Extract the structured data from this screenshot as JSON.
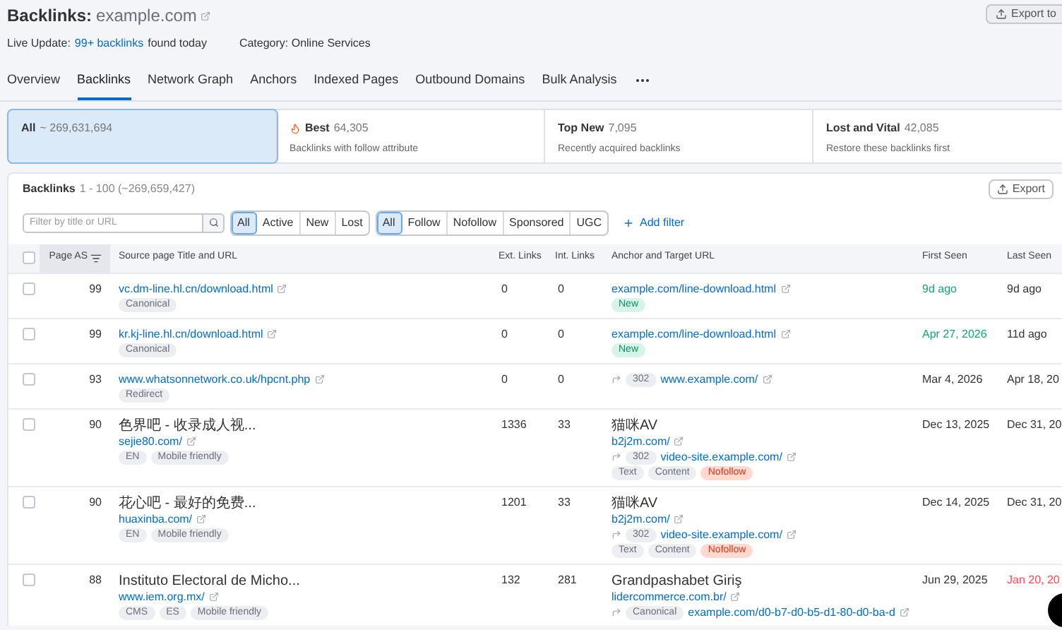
{
  "header": {
    "title_label": "Backlinks:",
    "domain": "example.com",
    "export_button": "Export to",
    "live_update_label": "Live Update:",
    "live_update_link": "99+ backlinks",
    "live_update_suffix": "found today",
    "category": "Category: Online Services"
  },
  "tabs": [
    {
      "label": "Overview",
      "selected": false
    },
    {
      "label": "Backlinks",
      "selected": true
    },
    {
      "label": "Network Graph",
      "selected": false
    },
    {
      "label": "Anchors",
      "selected": false
    },
    {
      "label": "Indexed Pages",
      "selected": false
    },
    {
      "label": "Outbound Domains",
      "selected": false
    },
    {
      "label": "Bulk Analysis",
      "selected": false
    }
  ],
  "summary_cards": [
    {
      "kind": "plain",
      "label": "All",
      "count": "~ 269,631,694",
      "selected": true
    },
    {
      "kind": "best",
      "label": "Best",
      "count": "64,305",
      "description": "Backlinks with follow attribute",
      "selected": false
    },
    {
      "kind": "plain",
      "label": "Top New",
      "count": "7,095",
      "description": "Recently acquired backlinks",
      "selected": false
    },
    {
      "kind": "plain",
      "label": "Lost and Vital",
      "count": "42,085",
      "description": "Restore these backlinks first",
      "selected": false
    }
  ],
  "table": {
    "title": "Backlinks",
    "range": "1 - 100 (~269,659,427)",
    "export_button": "Export",
    "search": {
      "placeholder": "Filter by title or URL"
    },
    "status_filters": [
      {
        "label": "All",
        "selected": true
      },
      {
        "label": "Active",
        "selected": false
      },
      {
        "label": "New",
        "selected": false
      },
      {
        "label": "Lost",
        "selected": false
      }
    ],
    "type_filters": [
      {
        "label": "All",
        "selected": true
      },
      {
        "label": "Follow",
        "selected": false
      },
      {
        "label": "Nofollow",
        "selected": false
      },
      {
        "label": "Sponsored",
        "selected": false
      },
      {
        "label": "UGC",
        "selected": false
      }
    ],
    "add_filter": "Add filter",
    "select_all_checked": false,
    "columns": [
      {
        "label": "Page AS",
        "sorted": true
      },
      {
        "label": "Source page Title and URL",
        "sorted": false
      },
      {
        "label": "Ext. Links",
        "sorted": false
      },
      {
        "label": "Int. Links",
        "sorted": false
      },
      {
        "label": "Anchor and Target URL",
        "sorted": false
      },
      {
        "label": "First Seen",
        "sorted": false
      },
      {
        "label": "Last Seen",
        "sorted": false
      }
    ],
    "rows": [
      {
        "checked": false,
        "page_as": "99",
        "source_url": "vc.dm-line.hl.cn/download.html",
        "source_tags": [
          "Canonical"
        ],
        "ext_links": "0",
        "int_links": "0",
        "anchor": {
          "url": "example.com/line-download.html",
          "tags": [
            {
              "label": "New",
              "kind": "new"
            }
          ]
        },
        "first_seen": "9d ago",
        "first_seen_recent": true,
        "last_seen": "9d ago",
        "last_seen_lost": false
      },
      {
        "checked": false,
        "page_as": "99",
        "source_url": "kr.kj-line.hl.cn/download.html",
        "source_tags": [
          "Canonical"
        ],
        "ext_links": "0",
        "int_links": "0",
        "anchor": {
          "url": "example.com/line-download.html",
          "tags": [
            {
              "label": "New",
              "kind": "new"
            }
          ]
        },
        "first_seen": "Apr 27, 2026",
        "first_seen_recent": true,
        "last_seen": "11d ago",
        "last_seen_lost": false
      },
      {
        "checked": false,
        "page_as": "93",
        "source_url": "www.whatsonnetwork.co.uk/hpcnt.php",
        "source_tags": [
          "Redirect"
        ],
        "ext_links": "0",
        "int_links": "0",
        "anchor": {
          "redirect": {
            "badge": "302",
            "url": "www.example.com/"
          }
        },
        "first_seen": "Mar 4, 2026",
        "first_seen_recent": false,
        "last_seen": "Apr 18, 20",
        "last_seen_lost": false
      },
      {
        "checked": false,
        "page_as": "90",
        "source_title": "色界吧 - 收录成人视...",
        "source_url": "sejie80.com/",
        "source_tags": [
          "EN",
          "Mobile friendly"
        ],
        "ext_links": "1336",
        "int_links": "33",
        "anchor": {
          "text": "猫咪AV",
          "url": "b2j2m.com/",
          "redirect": {
            "badge": "302",
            "url": "video-site.example.com/"
          },
          "tags": [
            {
              "label": "Text",
              "kind": "neutral"
            },
            {
              "label": "Content",
              "kind": "neutral"
            },
            {
              "label": "Nofollow",
              "kind": "nofollow"
            }
          ]
        },
        "first_seen": "Dec 13, 2025",
        "first_seen_recent": false,
        "last_seen": "Dec 31, 20",
        "last_seen_lost": false
      },
      {
        "checked": false,
        "page_as": "90",
        "source_title": "花心吧 - 最好的免费...",
        "source_url": "huaxinba.com/",
        "source_tags": [
          "EN",
          "Mobile friendly"
        ],
        "ext_links": "1201",
        "int_links": "33",
        "anchor": {
          "text": "猫咪AV",
          "url": "b2j2m.com/",
          "redirect": {
            "badge": "302",
            "url": "video-site.example.com/"
          },
          "tags": [
            {
              "label": "Text",
              "kind": "neutral"
            },
            {
              "label": "Content",
              "kind": "neutral"
            },
            {
              "label": "Nofollow",
              "kind": "nofollow"
            }
          ]
        },
        "first_seen": "Dec 14, 2025",
        "first_seen_recent": false,
        "last_seen": "Dec 31, 20",
        "last_seen_lost": false
      },
      {
        "checked": false,
        "page_as": "88",
        "source_title": "Instituto Electoral de Micho...",
        "source_url": "www.iem.org.mx/",
        "source_tags": [
          "CMS",
          "ES",
          "Mobile friendly"
        ],
        "ext_links": "132",
        "int_links": "281",
        "anchor": {
          "text": "Grandpashabet Giriş",
          "url": "lidercommerce.com.br/",
          "redirect": {
            "badge": "Canonical",
            "url": "example.com/d0-b7-d0-b5-d1-80-d0-ba-d"
          }
        },
        "first_seen": "Jun 29, 2025",
        "first_seen_recent": false,
        "last_seen": "Jan 20, 20",
        "last_seen_lost": true
      }
    ]
  }
}
